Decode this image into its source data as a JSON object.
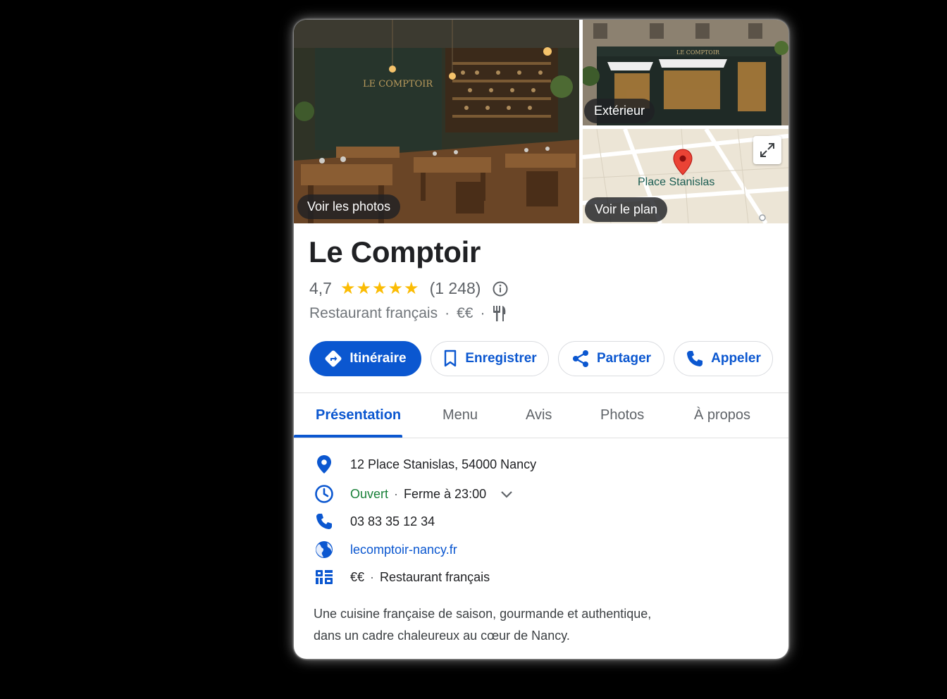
{
  "photos": {
    "main_label": "Voir les photos",
    "exterior_label": "Extérieur",
    "map_label": "Voir le plan",
    "map_place": "Place Stanislas",
    "sign_text": "LE COMPTOIR"
  },
  "place": {
    "name": "Le Comptoir",
    "rating": "4,7",
    "stars": "★★★★★",
    "review_count": "(1 248)",
    "category": "Restaurant français",
    "price": "€€",
    "dot": "·"
  },
  "actions": {
    "directions": "Itinéraire",
    "save": "Enregistrer",
    "share": "Partager",
    "call": "Appeler"
  },
  "tabs": [
    "Présentation",
    "Menu",
    "Avis",
    "Photos",
    "À propos"
  ],
  "details": {
    "address": "12 Place Stanislas, 54000 Nancy",
    "status": "Ouvert",
    "closes": "Ferme à 23:00",
    "phone": "03 83 35 12 34",
    "website": "lecomptoir-nancy.fr",
    "price": "€€",
    "category": "Restaurant français",
    "dot": "·"
  },
  "description": {
    "line1": "Une cuisine française de saison, gourmande et authentique,",
    "line2": "dans un cadre chaleureux au cœur de Nancy."
  },
  "colors": {
    "accent": "#0b57d0",
    "open": "#188038",
    "star": "#fbbc04",
    "pin": "#ea4335"
  }
}
